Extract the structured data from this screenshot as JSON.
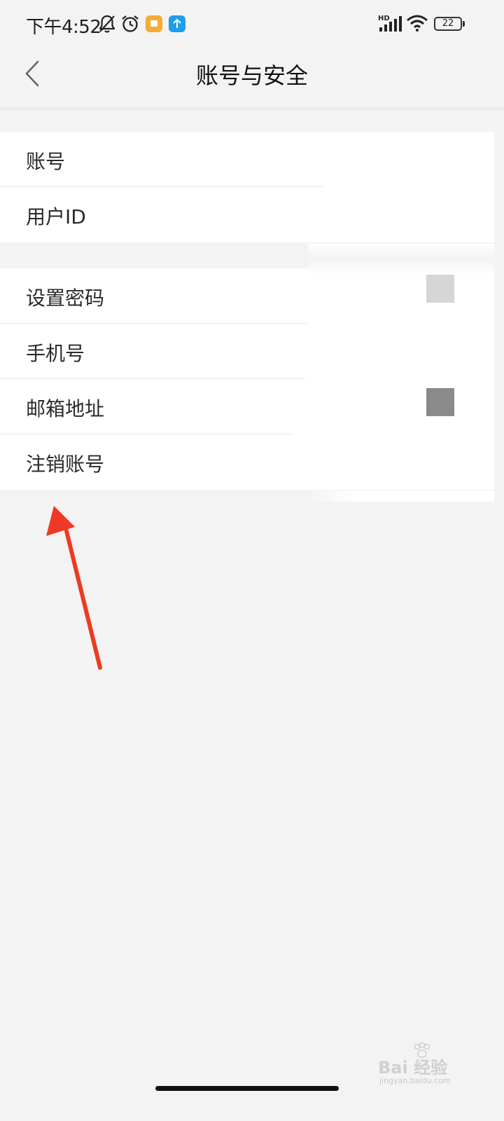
{
  "status_bar": {
    "time": "下午4:52",
    "network": "HD",
    "battery": "22",
    "icons": [
      "bell-off-icon",
      "alarm-clock-icon",
      "notification-app-icon",
      "upload-app-icon",
      "signal-icon",
      "wifi-icon",
      "battery-icon"
    ]
  },
  "nav": {
    "title": "账号与安全",
    "back_icon": "chevron-left-icon"
  },
  "groups": [
    {
      "items": [
        {
          "label": "账号"
        },
        {
          "label": "用户ID"
        }
      ]
    },
    {
      "items": [
        {
          "label": "设置密码"
        },
        {
          "label": "手机号"
        },
        {
          "label": "邮箱地址"
        },
        {
          "label": "注销账号"
        }
      ]
    }
  ],
  "colors": {
    "page_background": "#f3f3f3",
    "row_background": "#ffffff",
    "annotation_arrow": "#ee3a24",
    "redaction_light": "#d6d6d6",
    "redaction_dark": "#8a8a8a"
  },
  "watermark": {
    "line1": "Bai  经验",
    "line2": "jingyan.baidu.com"
  }
}
